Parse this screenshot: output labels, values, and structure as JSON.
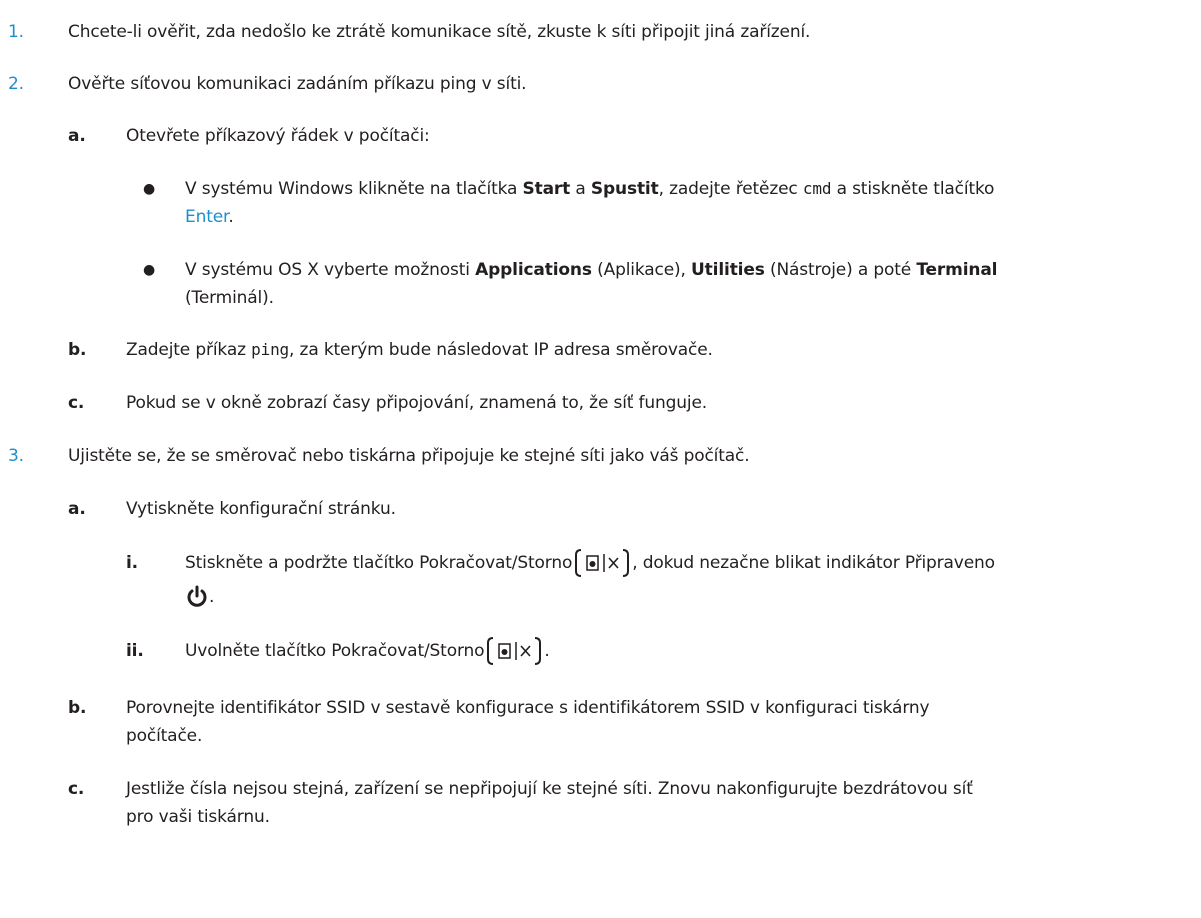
{
  "steps": [
    {
      "number": "1.",
      "text": "Chcete-li ověřit, zda nedošlo ke ztrátě komunikace sítě, zkuste k síti připojit jiná zařízení."
    },
    {
      "number": "2.",
      "text": "Ověřte síťovou komunikaci zadáním příkazu ping v síti.",
      "substeps": [
        {
          "letter": "a.",
          "text": "Otevřete příkazový řádek v počítači:",
          "bullets": [
            {
              "part1": "V systému Windows klikněte na tlačítka ",
              "bold1": "Start",
              "part2": " a ",
              "bold2": "Spustit",
              "part3": ", zadejte řetězec ",
              "code": "cmd",
              "part4": " a stiskněte tlačítko",
              "link": "Enter",
              "part5": "."
            },
            {
              "part1": "V systému OS X vyberte možnosti ",
              "bold1": "Applications",
              "part2": " (Aplikace), ",
              "bold2": "Utilities",
              "part3": " (Nástroje) a poté ",
              "bold3": "Terminal",
              "part4": "(Terminál)."
            }
          ]
        },
        {
          "letter": "b.",
          "part1": "Zadejte příkaz ",
          "code": "ping",
          "part2": ", za kterým bude následovat IP adresa směrovače."
        },
        {
          "letter": "c.",
          "text": "Pokud se v okně zobrazí časy připojování, znamená to, že síť funguje."
        }
      ]
    },
    {
      "number": "3.",
      "text": "Ujistěte se, že se směrovač nebo tiskárna připojuje ke stejné síti jako váš počítač.",
      "substeps": [
        {
          "letter": "a.",
          "text": "Vytiskněte konfigurační stránku.",
          "roman": [
            {
              "numeral": "i.",
              "part1": "Stiskněte a podržte tlačítko Pokračovat/Storno",
              "part2": ", dokud nezačne blikat indikátor Připraveno",
              "part3": "."
            },
            {
              "numeral": "ii.",
              "part1": "Uvolněte tlačítko Pokračovat/Storno",
              "part2": "."
            }
          ]
        },
        {
          "letter": "b.",
          "line1": "Porovnejte identifikátor SSID v sestavě konfigurace s identifikátorem SSID v konfiguraci tiskárny",
          "line2": "počítače."
        },
        {
          "letter": "c.",
          "line1": "Jestliže čísla nejsou stejná, zařízení se nepřipojují ke stejné síti. Znovu nakonfigurujte bezdrátovou síť",
          "line2": "pro vaši tiskárnu."
        }
      ]
    }
  ],
  "icons": {
    "resume_cancel": "resume-cancel-button-icon",
    "ready": "power-ready-icon"
  },
  "colors": {
    "accent": "#1c8fcd",
    "text": "#231f20"
  }
}
